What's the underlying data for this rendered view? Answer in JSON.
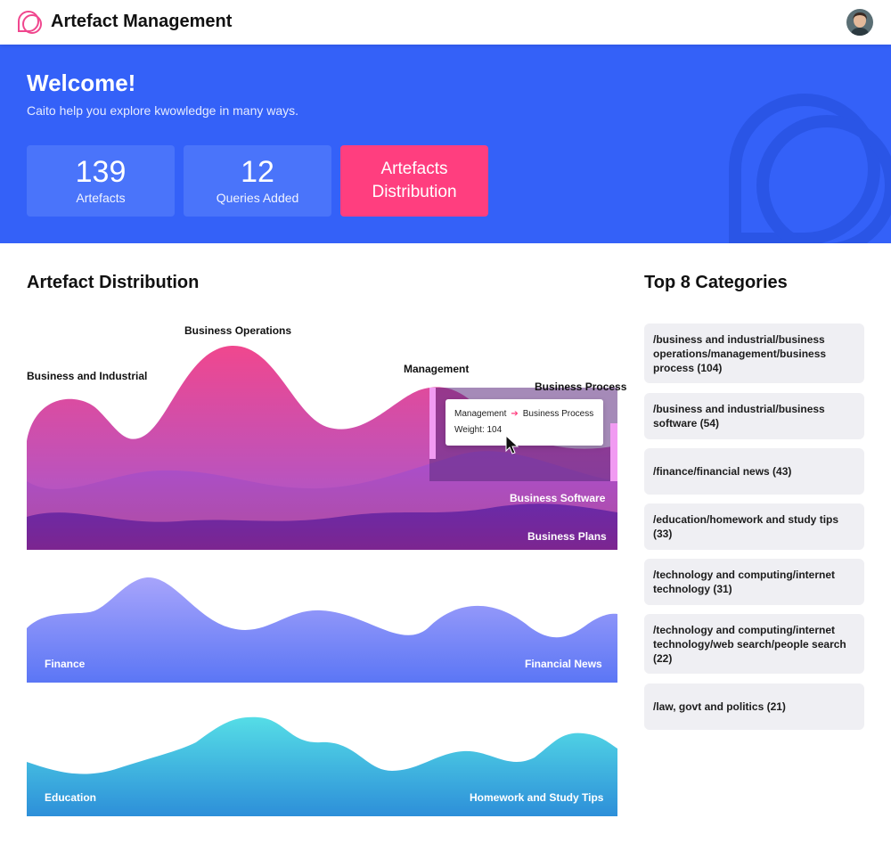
{
  "app": {
    "title": "Artefact Management",
    "logo_icon": "chat-bubbles-logo-icon",
    "avatar_icon": "user-avatar"
  },
  "hero": {
    "heading": "Welcome!",
    "subtitle": "Caito help you explore kwowledge in many ways.",
    "stats": [
      {
        "value": "139",
        "label": "Artefacts"
      },
      {
        "value": "12",
        "label": "Queries Added"
      }
    ],
    "cta_label": "Artefacts Distribution",
    "colors": {
      "background": "#3461f8",
      "card": "#4a74fa",
      "cta": "#ff3e7f"
    }
  },
  "distribution": {
    "title": "Artefact Distribution",
    "charts": [
      {
        "labels_dark": [
          "Business and Industrial",
          "Business Operations",
          "Management",
          "Business Process"
        ],
        "labels_light": [
          "Business Software",
          "Business Plans"
        ],
        "colors": [
          "#f0478e",
          "#a04ec9",
          "#5d25a0"
        ]
      },
      {
        "labels_light": [
          "Finance",
          "Financial News"
        ],
        "colors": [
          "#a7a4fb",
          "#5b76f5"
        ]
      },
      {
        "labels_light": [
          "Education",
          "Homework and Study Tips"
        ],
        "colors": [
          "#55dde6",
          "#2d8fd9"
        ]
      }
    ],
    "tooltip": {
      "from": "Management",
      "to": "Business Process",
      "weight_text": "Weight: 104"
    }
  },
  "categories": {
    "title": "Top 8 Categories",
    "items": [
      "/business and industrial/business operations/management/business process (104)",
      "/business and industrial/business software (54)",
      "/finance/financial news (43)",
      "/education/homework and study tips (33)",
      "/technology and computing/internet technology (31)",
      "/technology and computing/internet technology/web search/people search (22)",
      "/law, govt and politics (21)"
    ]
  }
}
